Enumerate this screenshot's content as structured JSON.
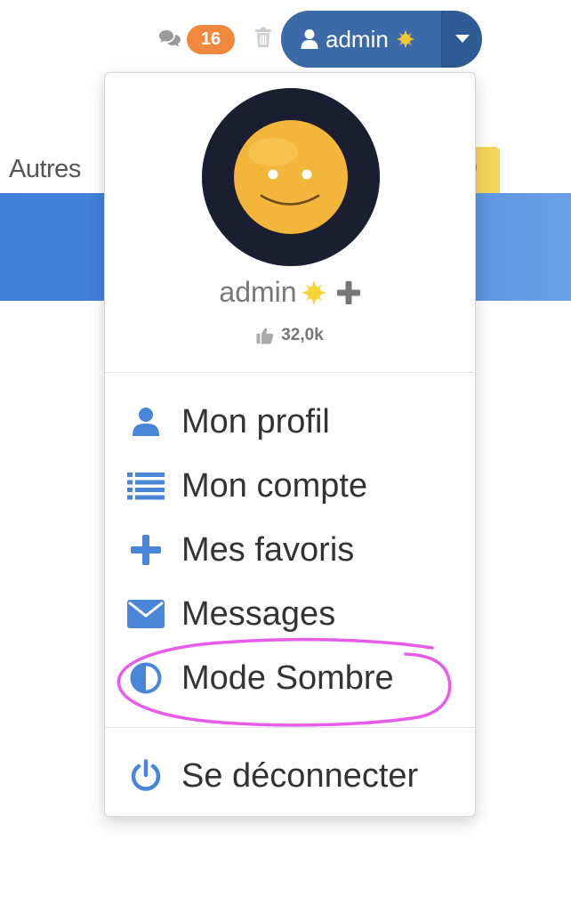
{
  "background": {
    "nav_text": "Autres"
  },
  "topbar": {
    "chat_icon": "comments-icon",
    "message_count": "16",
    "trash_icon": "trash-icon",
    "user_button": {
      "user_icon": "user-icon",
      "label": "admin",
      "status_icon": "sun-icon",
      "caret_icon": "caret-down-icon"
    }
  },
  "dropdown": {
    "avatar": "smiley-avatar",
    "profile_name": "admin",
    "profile_status_icon": "sun-icon",
    "add_icon": "plus-icon",
    "likes_icon": "thumbs-up-icon",
    "likes_count": "32,0k",
    "menu": [
      {
        "label": "Mon profil",
        "icon": "user-icon"
      },
      {
        "label": "Mon compte",
        "icon": "list-icon"
      },
      {
        "label": "Mes favoris",
        "icon": "plus-icon"
      },
      {
        "label": "Messages",
        "icon": "envelope-icon"
      },
      {
        "label": "Mode Sombre",
        "icon": "contrast-icon"
      },
      {
        "label": "Se déconnecter",
        "icon": "power-icon"
      }
    ],
    "highlighted_item": "Mode Sombre"
  },
  "colors": {
    "accent_blue": "#4a86d8",
    "user_button": "#3c6aa8",
    "badge": "#f0883e",
    "highlight_stroke": "#e85be8",
    "banner": "#4a87dc"
  }
}
